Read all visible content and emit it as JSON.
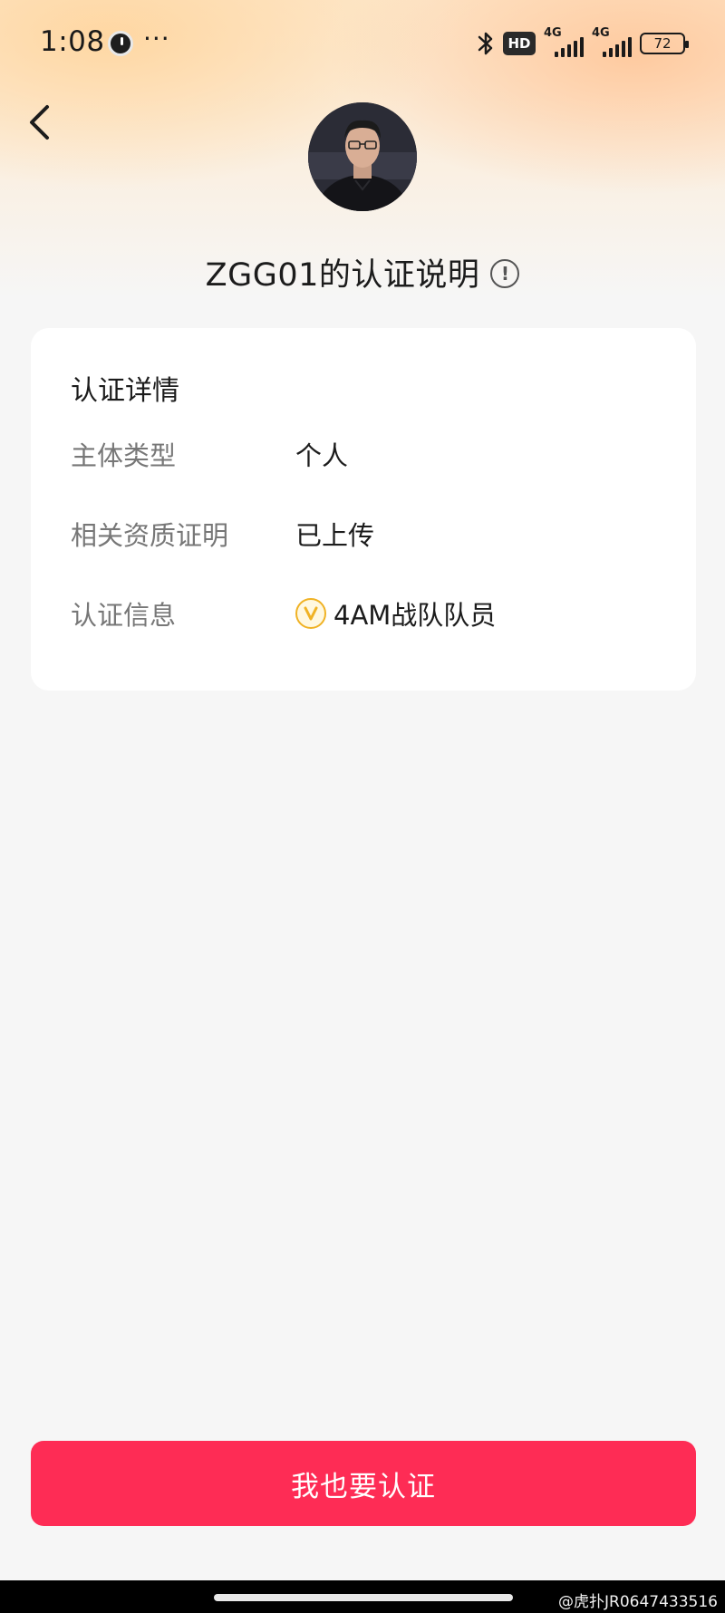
{
  "status_bar": {
    "time": "1:08",
    "more": "···",
    "hd_label": "HD",
    "network_1": "4G",
    "network_2": "4G",
    "battery": "72"
  },
  "header": {
    "title": "ZGG01的认证说明",
    "info_symbol": "!"
  },
  "card": {
    "title": "认证详情",
    "rows": [
      {
        "label": "主体类型",
        "value": "个人"
      },
      {
        "label": "相关资质证明",
        "value": "已上传"
      },
      {
        "label": "认证信息",
        "value": "4AM战队队员",
        "badge_icon": "v-verified-badge-icon"
      }
    ]
  },
  "cta": {
    "label": "我也要认证"
  },
  "watermark": "@虎扑JR0647433516",
  "colors": {
    "accent": "#fe2c55",
    "badge": "#f0b224",
    "background": "#f6f6f6"
  }
}
